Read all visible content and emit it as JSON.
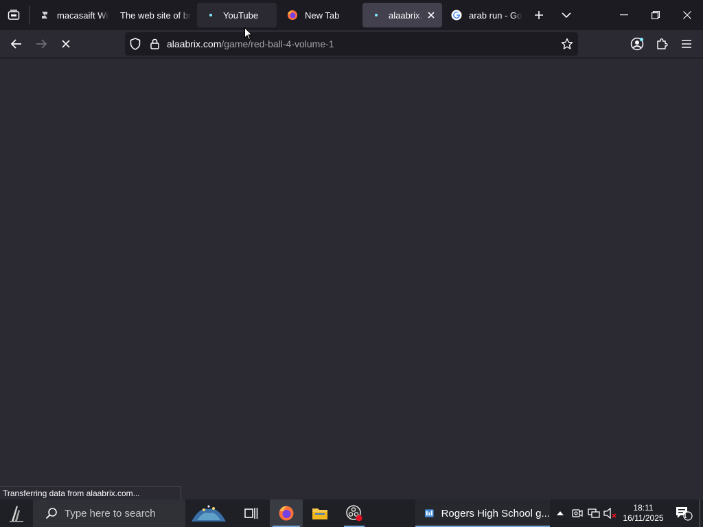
{
  "tabs": [
    {
      "title": "macasaift Win",
      "state": "normal",
      "icon": "site-icon"
    },
    {
      "title": "The web site of bro",
      "state": "normal",
      "icon": ""
    },
    {
      "title": "YouTube",
      "state": "hover",
      "icon": "loading-dot-icon"
    },
    {
      "title": "New Tab",
      "state": "normal",
      "icon": "firefox-icon"
    },
    {
      "title": "alaabrix.com",
      "state": "active",
      "icon": "loading-dot-icon"
    },
    {
      "title": "arab run - Goo",
      "state": "normal",
      "icon": "google-icon"
    }
  ],
  "url": {
    "domain": "alaabrix.com",
    "path": "/game/red-ball-4-volume-1"
  },
  "status_text": "Transferring data from alaabrix.com...",
  "taskbar": {
    "search_placeholder": "Type here to search",
    "pinned_window_label": "Rogers High School g...",
    "time": "18:11",
    "date": "16/11/2025",
    "notification_count": "1"
  },
  "colors": {
    "accent": "#80ebff",
    "chrome_dark": "#1c1b22",
    "content_bg": "#2b2a33"
  }
}
